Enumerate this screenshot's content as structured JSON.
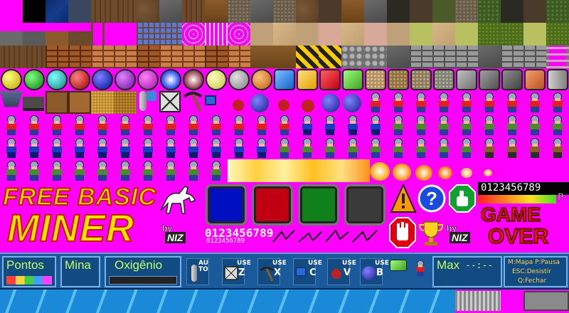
{
  "title": {
    "line1": "FREE BASIC",
    "line2": "MINER"
  },
  "credit": {
    "by": "by",
    "author": "NIZ"
  },
  "digits": {
    "large": "0123456789",
    "small": "0123456789",
    "lcd": "0123456789",
    "lcd_suffix": "P"
  },
  "game_over": {
    "line1": "GAME",
    "line2": "OVER"
  },
  "hud": {
    "points_label": "Pontos",
    "mine_label": "Mina",
    "oxygen_label": "Oxigênio",
    "auto_tag": "AU TO",
    "use_tag": "USE",
    "keys": {
      "box": "Z",
      "pick": "X",
      "drill": "C",
      "dynamite": "V",
      "bomb": "B"
    },
    "max_label": "Max",
    "max_value": "--:--",
    "help": {
      "map": "M:Mapa P:Pausa",
      "quit": "ESC:Desistir",
      "close": "Q:Fechar"
    }
  },
  "colors": {
    "magenta": "#ff00ff",
    "hud_blue": "#1a5a9a",
    "hud_label": "#c0ff60",
    "help_text": "#ffd040",
    "title_yellow": "#ffe000"
  },
  "icons": [
    "horse-icon",
    "warning-icon",
    "help-icon",
    "thumbs-up-icon",
    "stop-hand-icon",
    "trophy-icon",
    "pickaxe-icon",
    "bomb-icon",
    "dynamite-icon",
    "drill-icon",
    "oxygen-tank-icon"
  ]
}
